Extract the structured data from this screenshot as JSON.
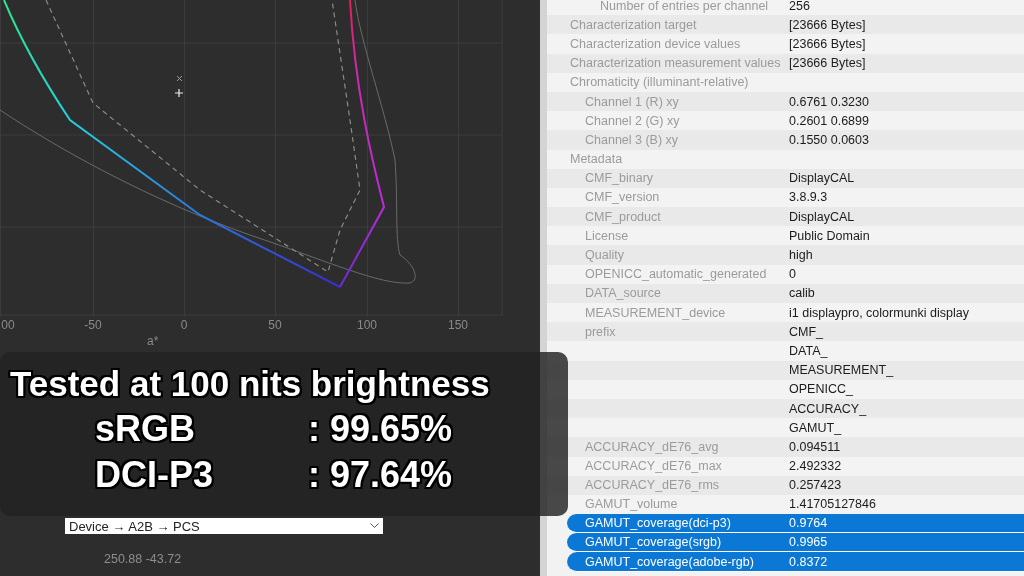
{
  "chart": {
    "x_ticks": [
      "00",
      "-50",
      "0",
      "50",
      "100",
      "150"
    ],
    "x_label": "a*"
  },
  "dropdown": {
    "value": "Device → A2B → PCS"
  },
  "cursor_reading": "250.88 -43.72",
  "overlay": {
    "title": "Tested at 100 nits brightness",
    "results": [
      {
        "name": "sRGB",
        "value": ": 99.65%"
      },
      {
        "name": "DCI-P3",
        "value": ": 97.64%"
      }
    ]
  },
  "properties": [
    {
      "children": [
        {
          "children": [
            {
              "label": "Number of entries per channel",
              "value": "256",
              "selected": false
            }
          ]
        }
      ]
    },
    {
      "label": "Characterization target",
      "value": "[23666 Bytes]",
      "selected": false
    },
    {
      "label": "Characterization device values",
      "value": "[23666 Bytes]",
      "selected": false
    },
    {
      "label": "Characterization measurement values",
      "value": "[23666 Bytes]",
      "selected": false
    },
    {
      "label": "Chromaticity (illuminant-relative)",
      "selected": false,
      "children": [
        {
          "label": "Channel 1 (R) xy",
          "value": "0.6761 0.3230",
          "selected": false
        },
        {
          "label": "Channel 2 (G) xy",
          "value": "0.2601 0.6899",
          "selected": false
        },
        {
          "label": "Channel 3 (B) xy",
          "value": "0.1550 0.0603",
          "selected": false
        }
      ]
    },
    {
      "label": "Metadata",
      "selected": false,
      "children": [
        {
          "label": "CMF_binary",
          "value": "DisplayCAL",
          "selected": false
        },
        {
          "label": "CMF_version",
          "value": "3.8.9.3",
          "selected": false
        },
        {
          "label": "CMF_product",
          "value": "DisplayCAL",
          "selected": false
        },
        {
          "label": "License",
          "value": "Public Domain",
          "selected": false
        },
        {
          "label": "Quality",
          "value": "high",
          "selected": false
        },
        {
          "label": "OPENICC_automatic_generated",
          "value": "0",
          "selected": false
        },
        {
          "label": "DATA_source",
          "value": "calib",
          "selected": false
        },
        {
          "label": "MEASUREMENT_device",
          "value": "i1 displaypro, colormunki display",
          "selected": false
        },
        {
          "label": "prefix",
          "values": [
            "CMF_",
            "DATA_",
            "MEASUREMENT_",
            "OPENICC_",
            "ACCURACY_",
            "GAMUT_"
          ],
          "selected": false
        },
        {
          "label": "ACCURACY_dE76_avg",
          "value": "0.094511",
          "selected": false
        },
        {
          "label": "ACCURACY_dE76_max",
          "value": "2.492332",
          "selected": false
        },
        {
          "label": "ACCURACY_dE76_rms",
          "value": "0.257423",
          "selected": false
        },
        {
          "label": "GAMUT_volume",
          "value": "1.41705127846",
          "selected": false
        },
        {
          "label": "GAMUT_coverage(dci-p3)",
          "value": "0.9764",
          "selected": true
        },
        {
          "label": "GAMUT_coverage(srgb)",
          "value": "0.9965",
          "selected": true
        },
        {
          "label": "GAMUT_coverage(adobe-rgb)",
          "value": "0.8372",
          "selected": true
        }
      ]
    }
  ]
}
